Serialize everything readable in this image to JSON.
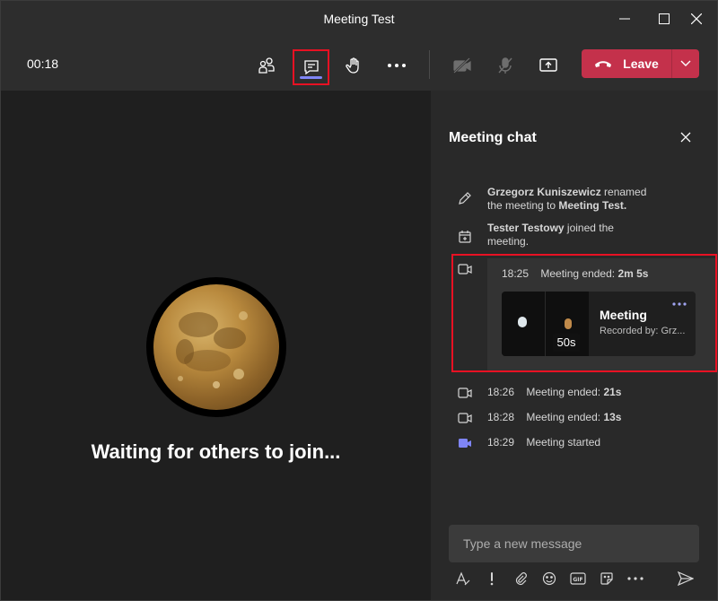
{
  "window": {
    "title": "Meeting Test"
  },
  "toolbar": {
    "timer": "00:18",
    "leave_label": "Leave",
    "icons": [
      "people-icon",
      "chat-icon",
      "raise-hand-icon",
      "more-icon",
      "camera-off-icon",
      "mic-off-icon",
      "share-screen-icon",
      "phone-hangup-icon",
      "chevron-down-icon"
    ]
  },
  "stage": {
    "waiting_text": "Waiting for others to join..."
  },
  "chat": {
    "title": "Meeting chat",
    "events": [
      {
        "icon": "pencil-icon",
        "actor": "Grzegorz Kuniszewicz",
        "text_a": " renamed",
        "text_b": "the meeting to ",
        "target": "Meeting Test."
      },
      {
        "icon": "calendar-join-icon",
        "actor": "Tester Testowy",
        "text_a": " joined the",
        "text_b": "meeting."
      }
    ],
    "recording": {
      "time": "18:25",
      "label": "Meeting ended: ",
      "duration": "2m 5s",
      "card_title": "Meeting",
      "recorded_by": "Recorded by: Grz...",
      "thumb_duration": "50s"
    },
    "meetings": [
      {
        "time": "18:26",
        "label": "Meeting ended: ",
        "duration": "21s",
        "icon": "video-icon"
      },
      {
        "time": "18:28",
        "label": "Meeting ended: ",
        "duration": "13s",
        "icon": "video-icon"
      },
      {
        "time": "18:29",
        "label": "Meeting started",
        "duration": "",
        "icon": "video-filled-icon"
      }
    ],
    "compose_placeholder": "Type a new message",
    "format_icons": [
      "format-icon",
      "important-icon",
      "attach-icon",
      "emoji-icon",
      "gif-icon",
      "sticker-icon",
      "more-icon",
      "send-icon"
    ]
  },
  "colors": {
    "leave": "#c4314b",
    "accent": "#7f85f5",
    "highlight": "#e81123",
    "panel": "#292929",
    "toolbar": "#2d2d2d"
  }
}
